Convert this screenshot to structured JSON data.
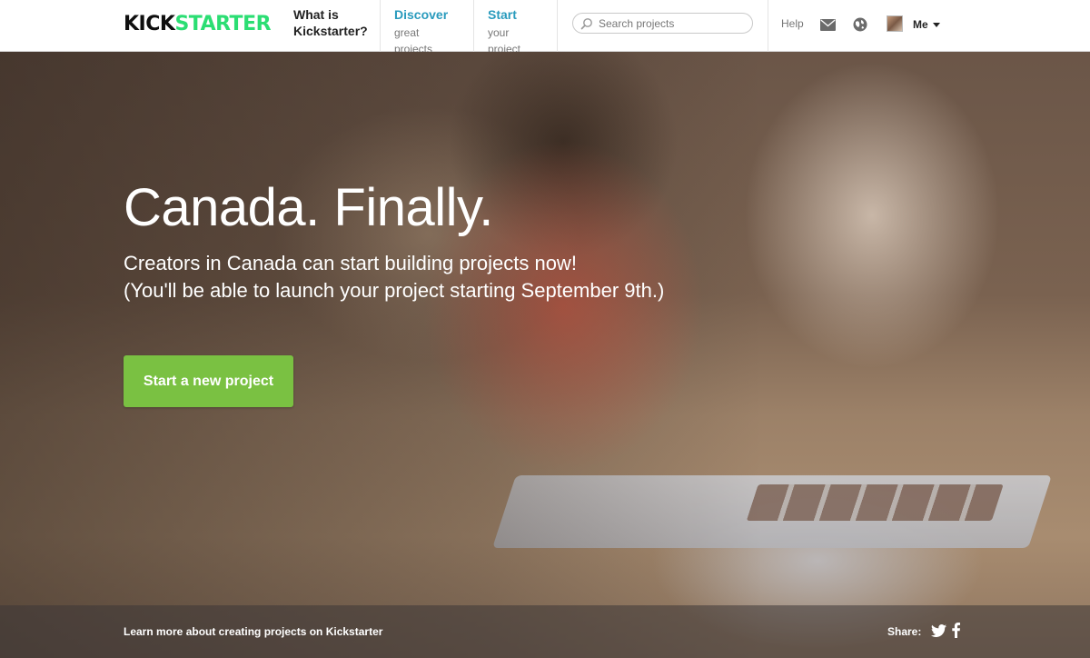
{
  "header": {
    "logo_kick": "KICK",
    "logo_starter": "STARTER",
    "nav": [
      {
        "line1": "What is",
        "line2": "Kickstarter?"
      },
      {
        "line1": "Discover",
        "line2": "great projects"
      },
      {
        "line1": "Start",
        "line2": "your project"
      }
    ],
    "search": {
      "placeholder": "Search projects",
      "value": ""
    },
    "help_label": "Help",
    "user_label": "Me"
  },
  "hero": {
    "title": "Canada. Finally.",
    "subtitle_line1": "Creators in Canada can start building projects now!",
    "subtitle_line2": "(You'll be able to launch your project starting September 9th.)",
    "cta_label": "Start a new project"
  },
  "footer": {
    "learn_more": "Learn more about creating projects on Kickstarter",
    "share_label": "Share:"
  },
  "icons": [
    "search-icon",
    "mail-icon",
    "globe-icon",
    "chevron-down-icon",
    "twitter-icon",
    "facebook-icon"
  ],
  "colors": {
    "brand_green": "#2bde73",
    "accent_blue": "#2a9bbd",
    "cta_green": "#7ac142"
  }
}
